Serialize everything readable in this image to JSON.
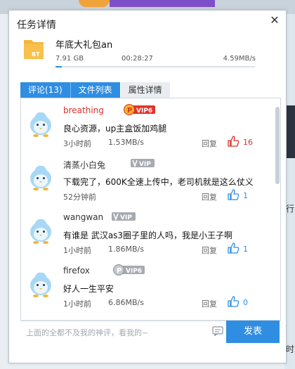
{
  "panel": {
    "title": "任务详情",
    "close_symbol": "✕"
  },
  "file": {
    "name": "年底大礼包an",
    "icon_label": "BT",
    "size": "7.91 GB",
    "elapsed": "00:28:27",
    "speed": "4.59MB/s",
    "progress_fraction": 0.03
  },
  "tabs": [
    {
      "label": "评论(13)"
    },
    {
      "label": "文件列表"
    },
    {
      "label": "属性详情"
    }
  ],
  "comments": [
    {
      "user": "breathing",
      "user_color": "#d9312b",
      "vip": "VIP6",
      "vip_style": "gold",
      "text": "良心资源，up主盒饭加鸡腿",
      "time": "3小时前",
      "speed": "1.53MB/s",
      "reply": "回复",
      "likes": "16",
      "liked": true
    },
    {
      "user": "清蒸小白兔",
      "user_color": "#333333",
      "vip": "VIP",
      "vip_style": "grey",
      "text": "下载完了，600K全速上传中，老司机就是这么仗义",
      "time": "52分钟前",
      "speed": "",
      "reply": "回复",
      "likes": "1",
      "liked": false
    },
    {
      "user": "wangwan",
      "user_color": "#333333",
      "vip": "VIP",
      "vip_style": "grey",
      "text": "有谁是 武汉as3圈子里的人吗，我是小王子啊",
      "time": "1小时前",
      "speed": "1.86MB/s",
      "reply": "回复",
      "likes": "1",
      "liked": false
    },
    {
      "user": "firefox",
      "user_color": "#333333",
      "vip": "VIP6",
      "vip_style": "greyp",
      "text": "好人一生平安",
      "time": "1小时前",
      "speed": "6.86MB/s",
      "reply": "回复",
      "likes": "0",
      "liked": false
    }
  ],
  "composer": {
    "placeholder": "上面的全都不及我的神评，看我的~",
    "send_label": "发表"
  },
  "background": {
    "right_text_1": "行",
    "right_text_2": "时"
  },
  "colors": {
    "accent": "#2f8ee2",
    "like_active": "#d9312b",
    "like_idle": "#2f8ee2"
  }
}
